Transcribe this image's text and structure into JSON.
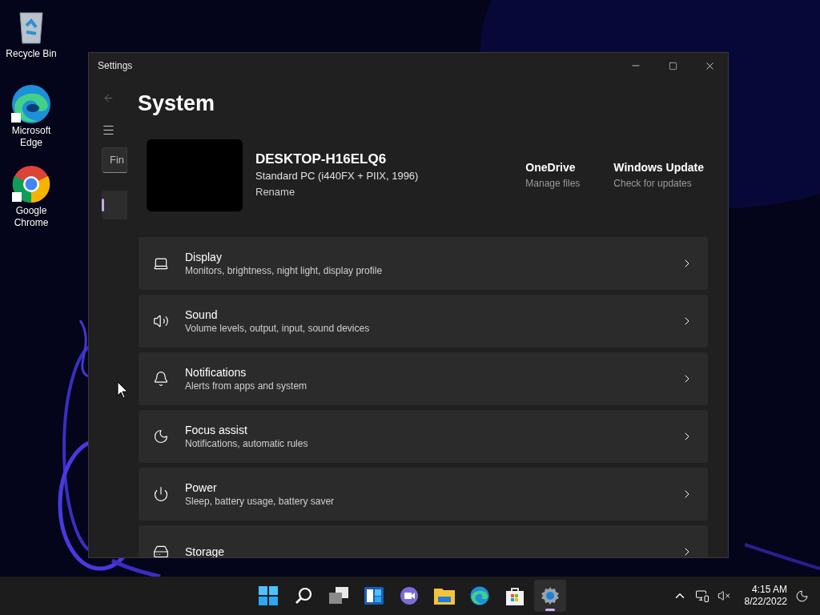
{
  "desktop_icons": [
    {
      "kind": "recycle",
      "label": "Recycle Bin"
    },
    {
      "kind": "edge",
      "label": "Microsoft Edge"
    },
    {
      "kind": "chrome",
      "label": "Google Chrome"
    }
  ],
  "window": {
    "title": "Settings"
  },
  "sidebar": {
    "search": {
      "placeholder": "Fin"
    },
    "nav_items": [
      {
        "selected": true
      }
    ]
  },
  "page": {
    "title": "System",
    "device": {
      "name": "DESKTOP-H16ELQ6",
      "model": "Standard PC (i440FX + PIIX, 1996)",
      "rename": "Rename"
    },
    "quick_links": [
      {
        "title": "OneDrive",
        "subtitle": "Manage files"
      },
      {
        "title": "Windows Update",
        "subtitle": "Check for updates"
      }
    ],
    "rows": [
      {
        "kind": "display",
        "title": "Display",
        "subtitle": "Monitors, brightness, night light, display profile"
      },
      {
        "kind": "sound",
        "title": "Sound",
        "subtitle": "Volume levels, output, input, sound devices"
      },
      {
        "kind": "notifications",
        "title": "Notifications",
        "subtitle": "Alerts from apps and system"
      },
      {
        "kind": "focus",
        "title": "Focus assist",
        "subtitle": "Notifications, automatic rules"
      },
      {
        "kind": "power",
        "title": "Power",
        "subtitle": "Sleep, battery usage, battery saver"
      },
      {
        "kind": "storage",
        "title": "Storage"
      }
    ]
  },
  "taskbar": {
    "apps": [
      {
        "kind": "start",
        "active": false
      },
      {
        "kind": "search",
        "active": false
      },
      {
        "kind": "taskview",
        "active": false
      },
      {
        "kind": "widgets",
        "active": false
      },
      {
        "kind": "chat",
        "active": false
      },
      {
        "kind": "explorer",
        "active": false
      },
      {
        "kind": "edge",
        "active": false
      },
      {
        "kind": "store",
        "active": false
      },
      {
        "kind": "settings",
        "active": true
      }
    ],
    "time": "4:15 AM",
    "date": "8/22/2022"
  }
}
